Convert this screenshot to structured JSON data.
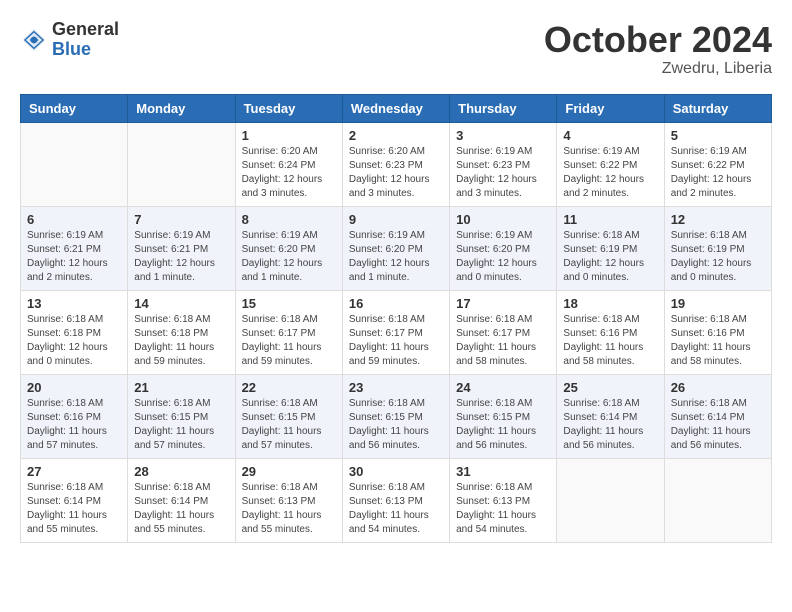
{
  "header": {
    "logo_general": "General",
    "logo_blue": "Blue",
    "month": "October 2024",
    "location": "Zwedru, Liberia"
  },
  "days_of_week": [
    "Sunday",
    "Monday",
    "Tuesday",
    "Wednesday",
    "Thursday",
    "Friday",
    "Saturday"
  ],
  "weeks": [
    [
      {
        "day": "",
        "info": ""
      },
      {
        "day": "",
        "info": ""
      },
      {
        "day": "1",
        "info": "Sunrise: 6:20 AM\nSunset: 6:24 PM\nDaylight: 12 hours and 3 minutes."
      },
      {
        "day": "2",
        "info": "Sunrise: 6:20 AM\nSunset: 6:23 PM\nDaylight: 12 hours and 3 minutes."
      },
      {
        "day": "3",
        "info": "Sunrise: 6:19 AM\nSunset: 6:23 PM\nDaylight: 12 hours and 3 minutes."
      },
      {
        "day": "4",
        "info": "Sunrise: 6:19 AM\nSunset: 6:22 PM\nDaylight: 12 hours and 2 minutes."
      },
      {
        "day": "5",
        "info": "Sunrise: 6:19 AM\nSunset: 6:22 PM\nDaylight: 12 hours and 2 minutes."
      }
    ],
    [
      {
        "day": "6",
        "info": "Sunrise: 6:19 AM\nSunset: 6:21 PM\nDaylight: 12 hours and 2 minutes."
      },
      {
        "day": "7",
        "info": "Sunrise: 6:19 AM\nSunset: 6:21 PM\nDaylight: 12 hours and 1 minute."
      },
      {
        "day": "8",
        "info": "Sunrise: 6:19 AM\nSunset: 6:20 PM\nDaylight: 12 hours and 1 minute."
      },
      {
        "day": "9",
        "info": "Sunrise: 6:19 AM\nSunset: 6:20 PM\nDaylight: 12 hours and 1 minute."
      },
      {
        "day": "10",
        "info": "Sunrise: 6:19 AM\nSunset: 6:20 PM\nDaylight: 12 hours and 0 minutes."
      },
      {
        "day": "11",
        "info": "Sunrise: 6:18 AM\nSunset: 6:19 PM\nDaylight: 12 hours and 0 minutes."
      },
      {
        "day": "12",
        "info": "Sunrise: 6:18 AM\nSunset: 6:19 PM\nDaylight: 12 hours and 0 minutes."
      }
    ],
    [
      {
        "day": "13",
        "info": "Sunrise: 6:18 AM\nSunset: 6:18 PM\nDaylight: 12 hours and 0 minutes."
      },
      {
        "day": "14",
        "info": "Sunrise: 6:18 AM\nSunset: 6:18 PM\nDaylight: 11 hours and 59 minutes."
      },
      {
        "day": "15",
        "info": "Sunrise: 6:18 AM\nSunset: 6:17 PM\nDaylight: 11 hours and 59 minutes."
      },
      {
        "day": "16",
        "info": "Sunrise: 6:18 AM\nSunset: 6:17 PM\nDaylight: 11 hours and 59 minutes."
      },
      {
        "day": "17",
        "info": "Sunrise: 6:18 AM\nSunset: 6:17 PM\nDaylight: 11 hours and 58 minutes."
      },
      {
        "day": "18",
        "info": "Sunrise: 6:18 AM\nSunset: 6:16 PM\nDaylight: 11 hours and 58 minutes."
      },
      {
        "day": "19",
        "info": "Sunrise: 6:18 AM\nSunset: 6:16 PM\nDaylight: 11 hours and 58 minutes."
      }
    ],
    [
      {
        "day": "20",
        "info": "Sunrise: 6:18 AM\nSunset: 6:16 PM\nDaylight: 11 hours and 57 minutes."
      },
      {
        "day": "21",
        "info": "Sunrise: 6:18 AM\nSunset: 6:15 PM\nDaylight: 11 hours and 57 minutes."
      },
      {
        "day": "22",
        "info": "Sunrise: 6:18 AM\nSunset: 6:15 PM\nDaylight: 11 hours and 57 minutes."
      },
      {
        "day": "23",
        "info": "Sunrise: 6:18 AM\nSunset: 6:15 PM\nDaylight: 11 hours and 56 minutes."
      },
      {
        "day": "24",
        "info": "Sunrise: 6:18 AM\nSunset: 6:15 PM\nDaylight: 11 hours and 56 minutes."
      },
      {
        "day": "25",
        "info": "Sunrise: 6:18 AM\nSunset: 6:14 PM\nDaylight: 11 hours and 56 minutes."
      },
      {
        "day": "26",
        "info": "Sunrise: 6:18 AM\nSunset: 6:14 PM\nDaylight: 11 hours and 56 minutes."
      }
    ],
    [
      {
        "day": "27",
        "info": "Sunrise: 6:18 AM\nSunset: 6:14 PM\nDaylight: 11 hours and 55 minutes."
      },
      {
        "day": "28",
        "info": "Sunrise: 6:18 AM\nSunset: 6:14 PM\nDaylight: 11 hours and 55 minutes."
      },
      {
        "day": "29",
        "info": "Sunrise: 6:18 AM\nSunset: 6:13 PM\nDaylight: 11 hours and 55 minutes."
      },
      {
        "day": "30",
        "info": "Sunrise: 6:18 AM\nSunset: 6:13 PM\nDaylight: 11 hours and 54 minutes."
      },
      {
        "day": "31",
        "info": "Sunrise: 6:18 AM\nSunset: 6:13 PM\nDaylight: 11 hours and 54 minutes."
      },
      {
        "day": "",
        "info": ""
      },
      {
        "day": "",
        "info": ""
      }
    ]
  ]
}
